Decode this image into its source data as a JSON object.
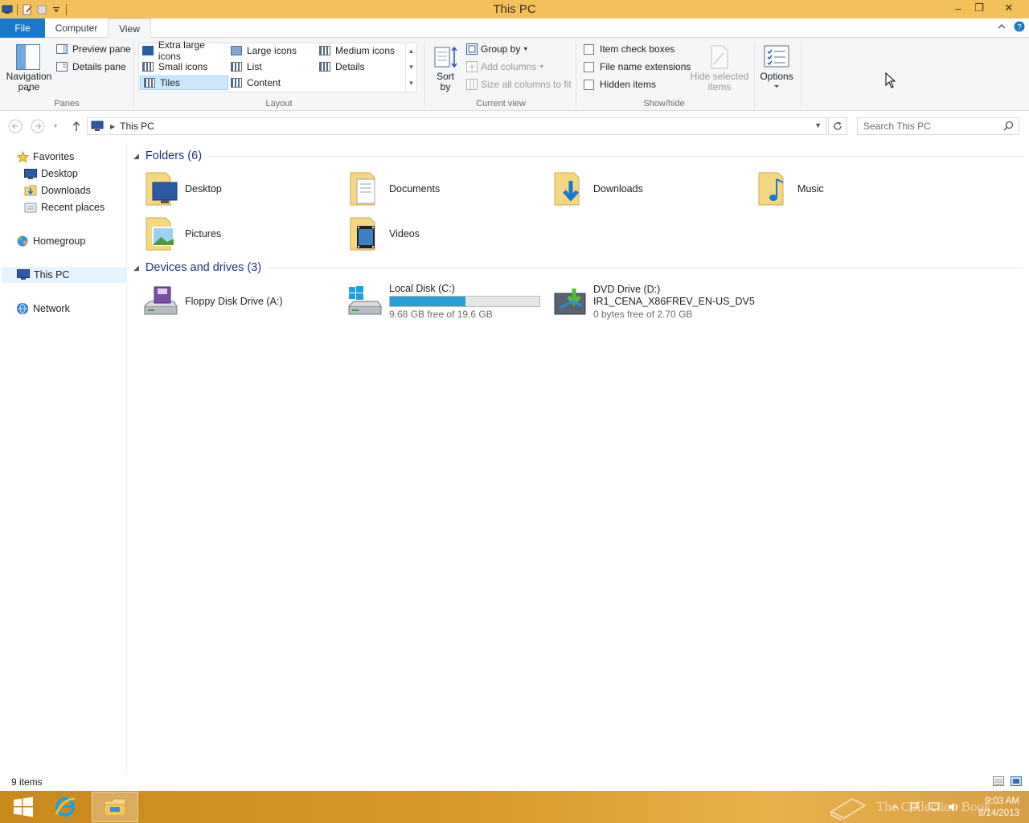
{
  "window": {
    "title": "This PC",
    "minimize_glyph": "–",
    "maximize_glyph": "❐",
    "close_glyph": "✕"
  },
  "ribbon_tabs": {
    "file": "File",
    "computer": "Computer",
    "view": "View"
  },
  "panes": {
    "label": "Panes",
    "navigation_pane": "Navigation pane",
    "preview_pane": "Preview pane",
    "details_pane": "Details pane"
  },
  "layout": {
    "label": "Layout",
    "items": [
      "Extra large icons",
      "Large icons",
      "Medium icons",
      "Small icons",
      "List",
      "Details",
      "Tiles",
      "Content"
    ],
    "selected": "Tiles"
  },
  "current_view": {
    "label": "Current view",
    "sort_by": "Sort by",
    "group_by": "Group by",
    "add_columns": "Add columns",
    "size_all_columns": "Size all columns to fit"
  },
  "show_hide": {
    "label": "Show/hide",
    "item_check_boxes": "Item check boxes",
    "file_name_extensions": "File name extensions",
    "hidden_items": "Hidden items",
    "hide_selected_items": "Hide selected items"
  },
  "options": {
    "label": "Options"
  },
  "address": {
    "path": "This PC",
    "search_placeholder": "Search This PC"
  },
  "nav_pane": {
    "favorites": "Favorites",
    "desktop": "Desktop",
    "downloads": "Downloads",
    "recent_places": "Recent places",
    "homegroup": "Homegroup",
    "this_pc": "This PC",
    "network": "Network"
  },
  "folders_group": {
    "title": "Folders (6)",
    "items": [
      "Desktop",
      "Documents",
      "Downloads",
      "Music",
      "Pictures",
      "Videos"
    ]
  },
  "drives_group": {
    "title": "Devices and drives (3)",
    "floppy": {
      "name": "Floppy Disk Drive (A:)"
    },
    "local": {
      "name": "Local Disk (C:)",
      "free_text": "9.68 GB free of 19.6 GB",
      "used_fraction": 0.506
    },
    "dvd": {
      "name": "DVD Drive (D:)",
      "label": "IR1_CENA_X86FREV_EN-US_DV5",
      "free_text": "0 bytes free of 2.70 GB"
    }
  },
  "status": {
    "item_count": "9 items"
  },
  "taskbar": {
    "time": "9:03 AM",
    "date": "9/14/2013",
    "watermark": "The Collection Book"
  },
  "colors": {
    "titlebar": "#f3c15a",
    "file_tab": "#1979ca",
    "accent_blue": "#26a0da",
    "group_title": "#1e3287"
  }
}
